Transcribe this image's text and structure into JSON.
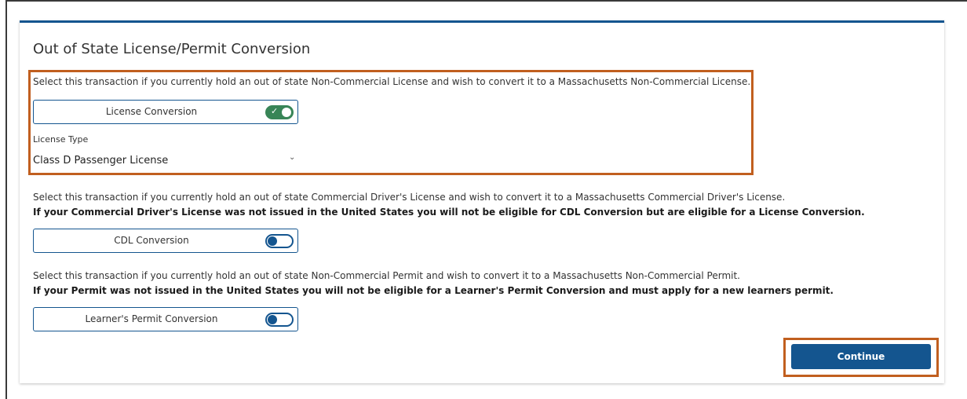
{
  "page": {
    "title": "Out of State License/Permit Conversion"
  },
  "license_conversion": {
    "description": "Select this transaction if you currently hold an out of state Non-Commercial License and wish to convert it to a Massachusetts Non-Commercial License.",
    "toggle_label": "License Conversion",
    "toggle_state": "on",
    "license_type_label": "License Type",
    "license_type_value": "Class D Passenger License"
  },
  "cdl_conversion": {
    "description": "Select this transaction if you currently hold an out of state Commercial Driver's License and wish to convert it to a Massachusetts Commercial Driver's License.",
    "notice": "If your Commercial Driver's License was not issued in the United States you will not be eligible for CDL Conversion but are eligible for a License Conversion.",
    "toggle_label": "CDL Conversion",
    "toggle_state": "off"
  },
  "permit_conversion": {
    "description": "Select this transaction if you currently hold an out of state Non-Commercial Permit and wish to convert it to a Massachusetts Non-Commercial Permit.",
    "notice": "If your Permit was not issued in the United States you will not be eligible for a Learner's Permit Conversion and must apply for a new learners permit.",
    "toggle_label": "Learner's Permit Conversion",
    "toggle_state": "off"
  },
  "actions": {
    "continue_label": "Continue"
  },
  "colors": {
    "primary": "#14558f",
    "toggle_on": "#388557",
    "highlight": "#c15f1f"
  }
}
